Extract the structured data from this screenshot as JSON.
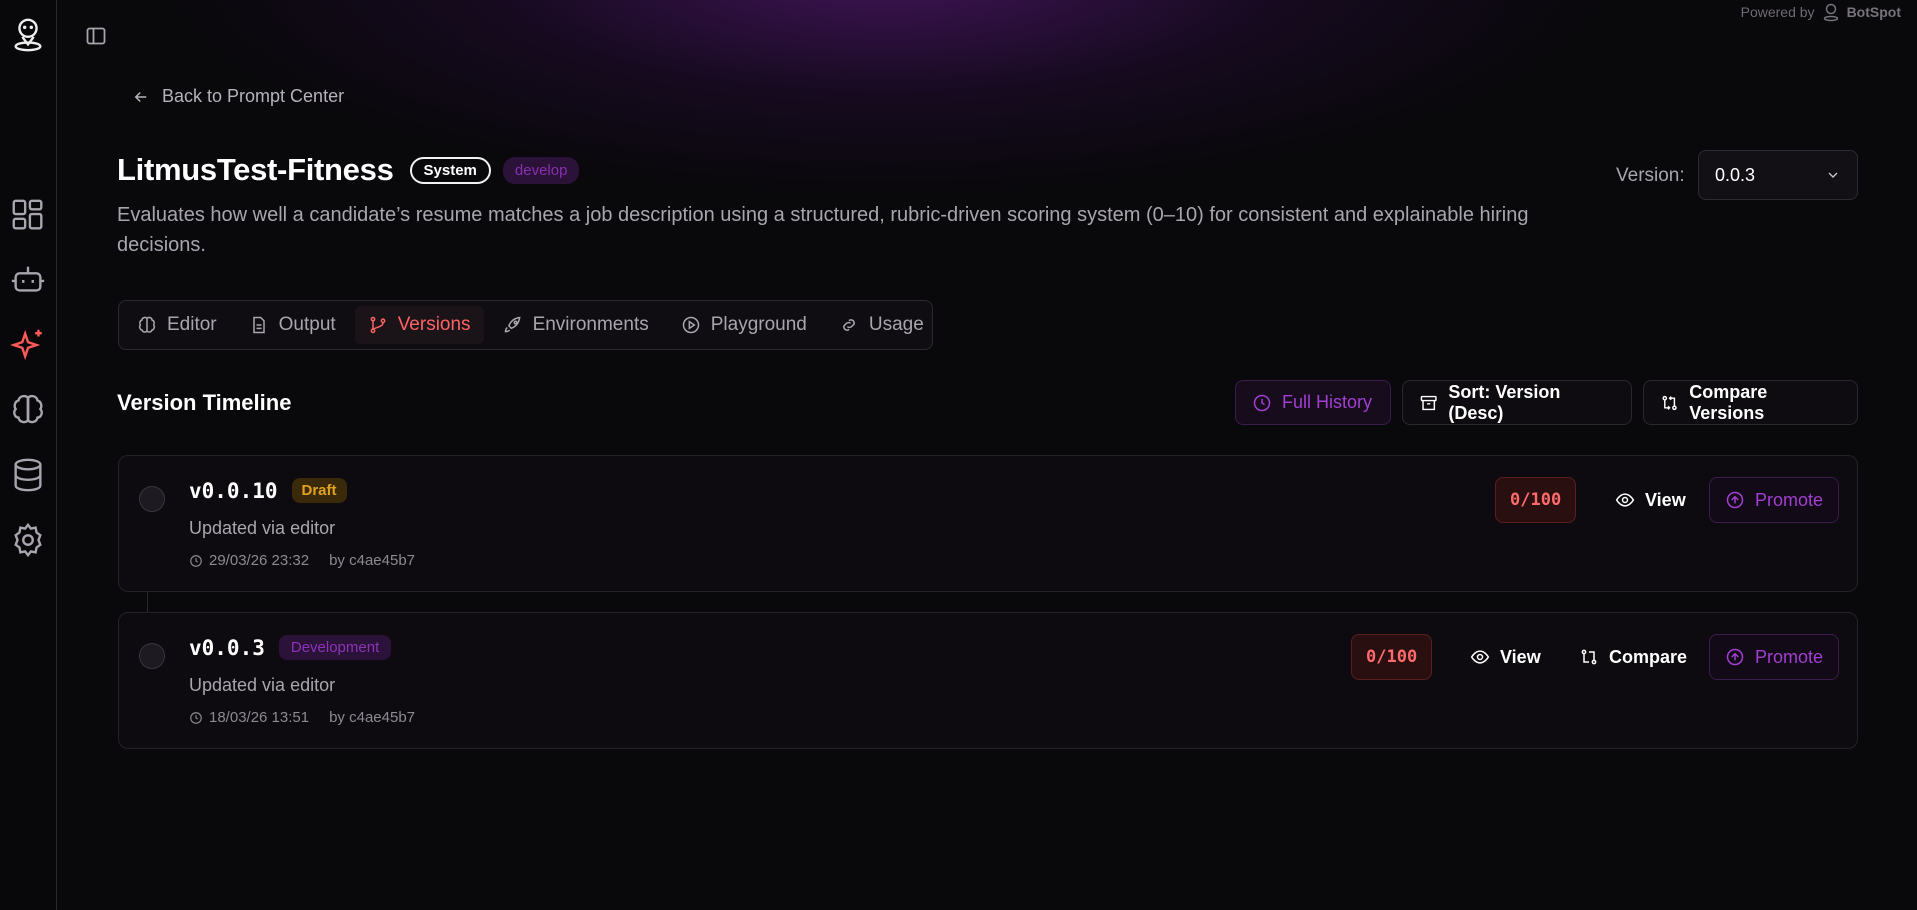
{
  "header": {
    "powered_by_label": "Powered by",
    "powered_by_brand": "BotSpot"
  },
  "sidebar": {
    "items": [
      {
        "icon": "dashboard-icon"
      },
      {
        "icon": "bot-icon"
      },
      {
        "icon": "sparkles-icon",
        "active": true
      },
      {
        "icon": "brain-icon"
      },
      {
        "icon": "database-icon"
      },
      {
        "icon": "gear-icon"
      }
    ]
  },
  "page": {
    "back_label": "Back to Prompt Center",
    "title": "LitmusTest-Fitness",
    "badge_system": "System",
    "badge_env": "develop",
    "description": "Evaluates how well a candidate’s resume matches a job description using a structured, rubric-driven scoring system (0–10) for consistent and explainable hiring decisions.",
    "version_label": "Version:",
    "version_value": "0.0.3"
  },
  "tabs": [
    {
      "label": "Editor",
      "icon": "brain-icon"
    },
    {
      "label": "Output",
      "icon": "file-icon"
    },
    {
      "label": "Versions",
      "icon": "git-branch-icon",
      "active": true
    },
    {
      "label": "Environments",
      "icon": "rocket-icon"
    },
    {
      "label": "Playground",
      "icon": "play-circle-icon"
    },
    {
      "label": "Usage",
      "icon": "link-icon"
    }
  ],
  "timeline": {
    "title": "Version Timeline",
    "full_history": "Full History",
    "sort": "Sort: Version (Desc)",
    "compare_versions": "Compare Versions",
    "versions": [
      {
        "version": "v0.0.10",
        "badge": "Draft",
        "note": "Updated via editor",
        "timestamp": "29/03/26 23:32",
        "author": "by c4ae45b7",
        "score": "0/100",
        "view": "View",
        "promote": "Promote"
      },
      {
        "version": "v0.0.3",
        "badge": "Development",
        "note": "Updated via editor",
        "timestamp": "18/03/26 13:51",
        "author": "by c4ae45b7",
        "score": "0/100",
        "view": "View",
        "compare": "Compare",
        "promote": "Promote"
      }
    ]
  },
  "colors": {
    "accent_red": "#ff6262",
    "accent_purple": "#a23ed2",
    "draft_amber": "#e2a21e",
    "background": "#09080b"
  }
}
